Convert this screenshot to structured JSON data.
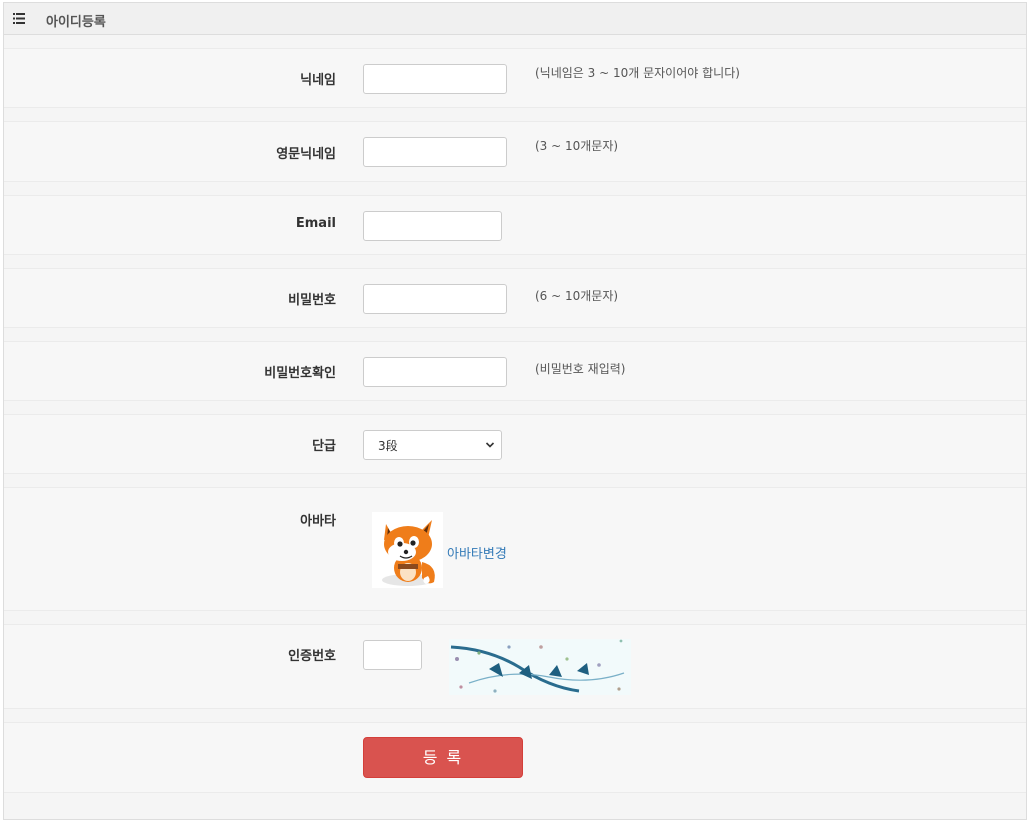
{
  "header": {
    "title": "아이디등록",
    "icon": "list-icon"
  },
  "form": {
    "nickname": {
      "label": "닉네임",
      "value": "",
      "help": "(닉네임은 3 ~ 10개 문자이어야 합니다)"
    },
    "eng_nickname": {
      "label": "영문닉네임",
      "value": "",
      "help": "(3 ~ 10개문자)"
    },
    "email": {
      "label": "Email",
      "value": ""
    },
    "password": {
      "label": "비밀번호",
      "value": "",
      "help": "(6 ~ 10개문자)"
    },
    "password_confirm": {
      "label": "비밀번호확인",
      "value": "",
      "help": "(비밀번호 재입력)"
    },
    "rank": {
      "label": "단급",
      "selected": "3段"
    },
    "avatar": {
      "label": "아바타",
      "change_link": "아바타변경",
      "icon": "fox-avatar-icon"
    },
    "captcha": {
      "label": "인증번호",
      "value": ""
    },
    "submit_label": "등 록"
  },
  "colors": {
    "submit": "#d9534f",
    "link": "#337ab7",
    "panel_bg": "#f5f5f5"
  }
}
